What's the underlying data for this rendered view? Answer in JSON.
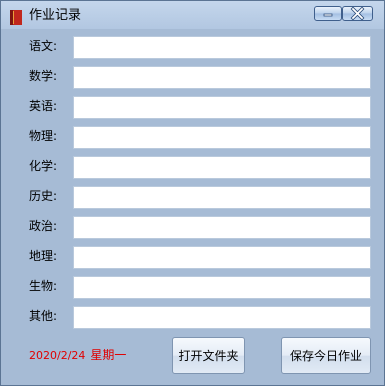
{
  "window": {
    "title": "作业记录"
  },
  "subjects": [
    {
      "label": "语文:",
      "value": ""
    },
    {
      "label": "数学:",
      "value": ""
    },
    {
      "label": "英语:",
      "value": ""
    },
    {
      "label": "物理:",
      "value": ""
    },
    {
      "label": "化学:",
      "value": ""
    },
    {
      "label": "历史:",
      "value": ""
    },
    {
      "label": "政治:",
      "value": ""
    },
    {
      "label": "地理:",
      "value": ""
    },
    {
      "label": "生物:",
      "value": ""
    },
    {
      "label": "其他:",
      "value": ""
    }
  ],
  "footer": {
    "date": "2020/2/24",
    "weekday": "星期一",
    "open_folder_label": "打开文件夹",
    "save_today_label": "保存今日作业"
  },
  "colors": {
    "window_bg": "#a6bbd5",
    "date_text": "#e00000"
  }
}
